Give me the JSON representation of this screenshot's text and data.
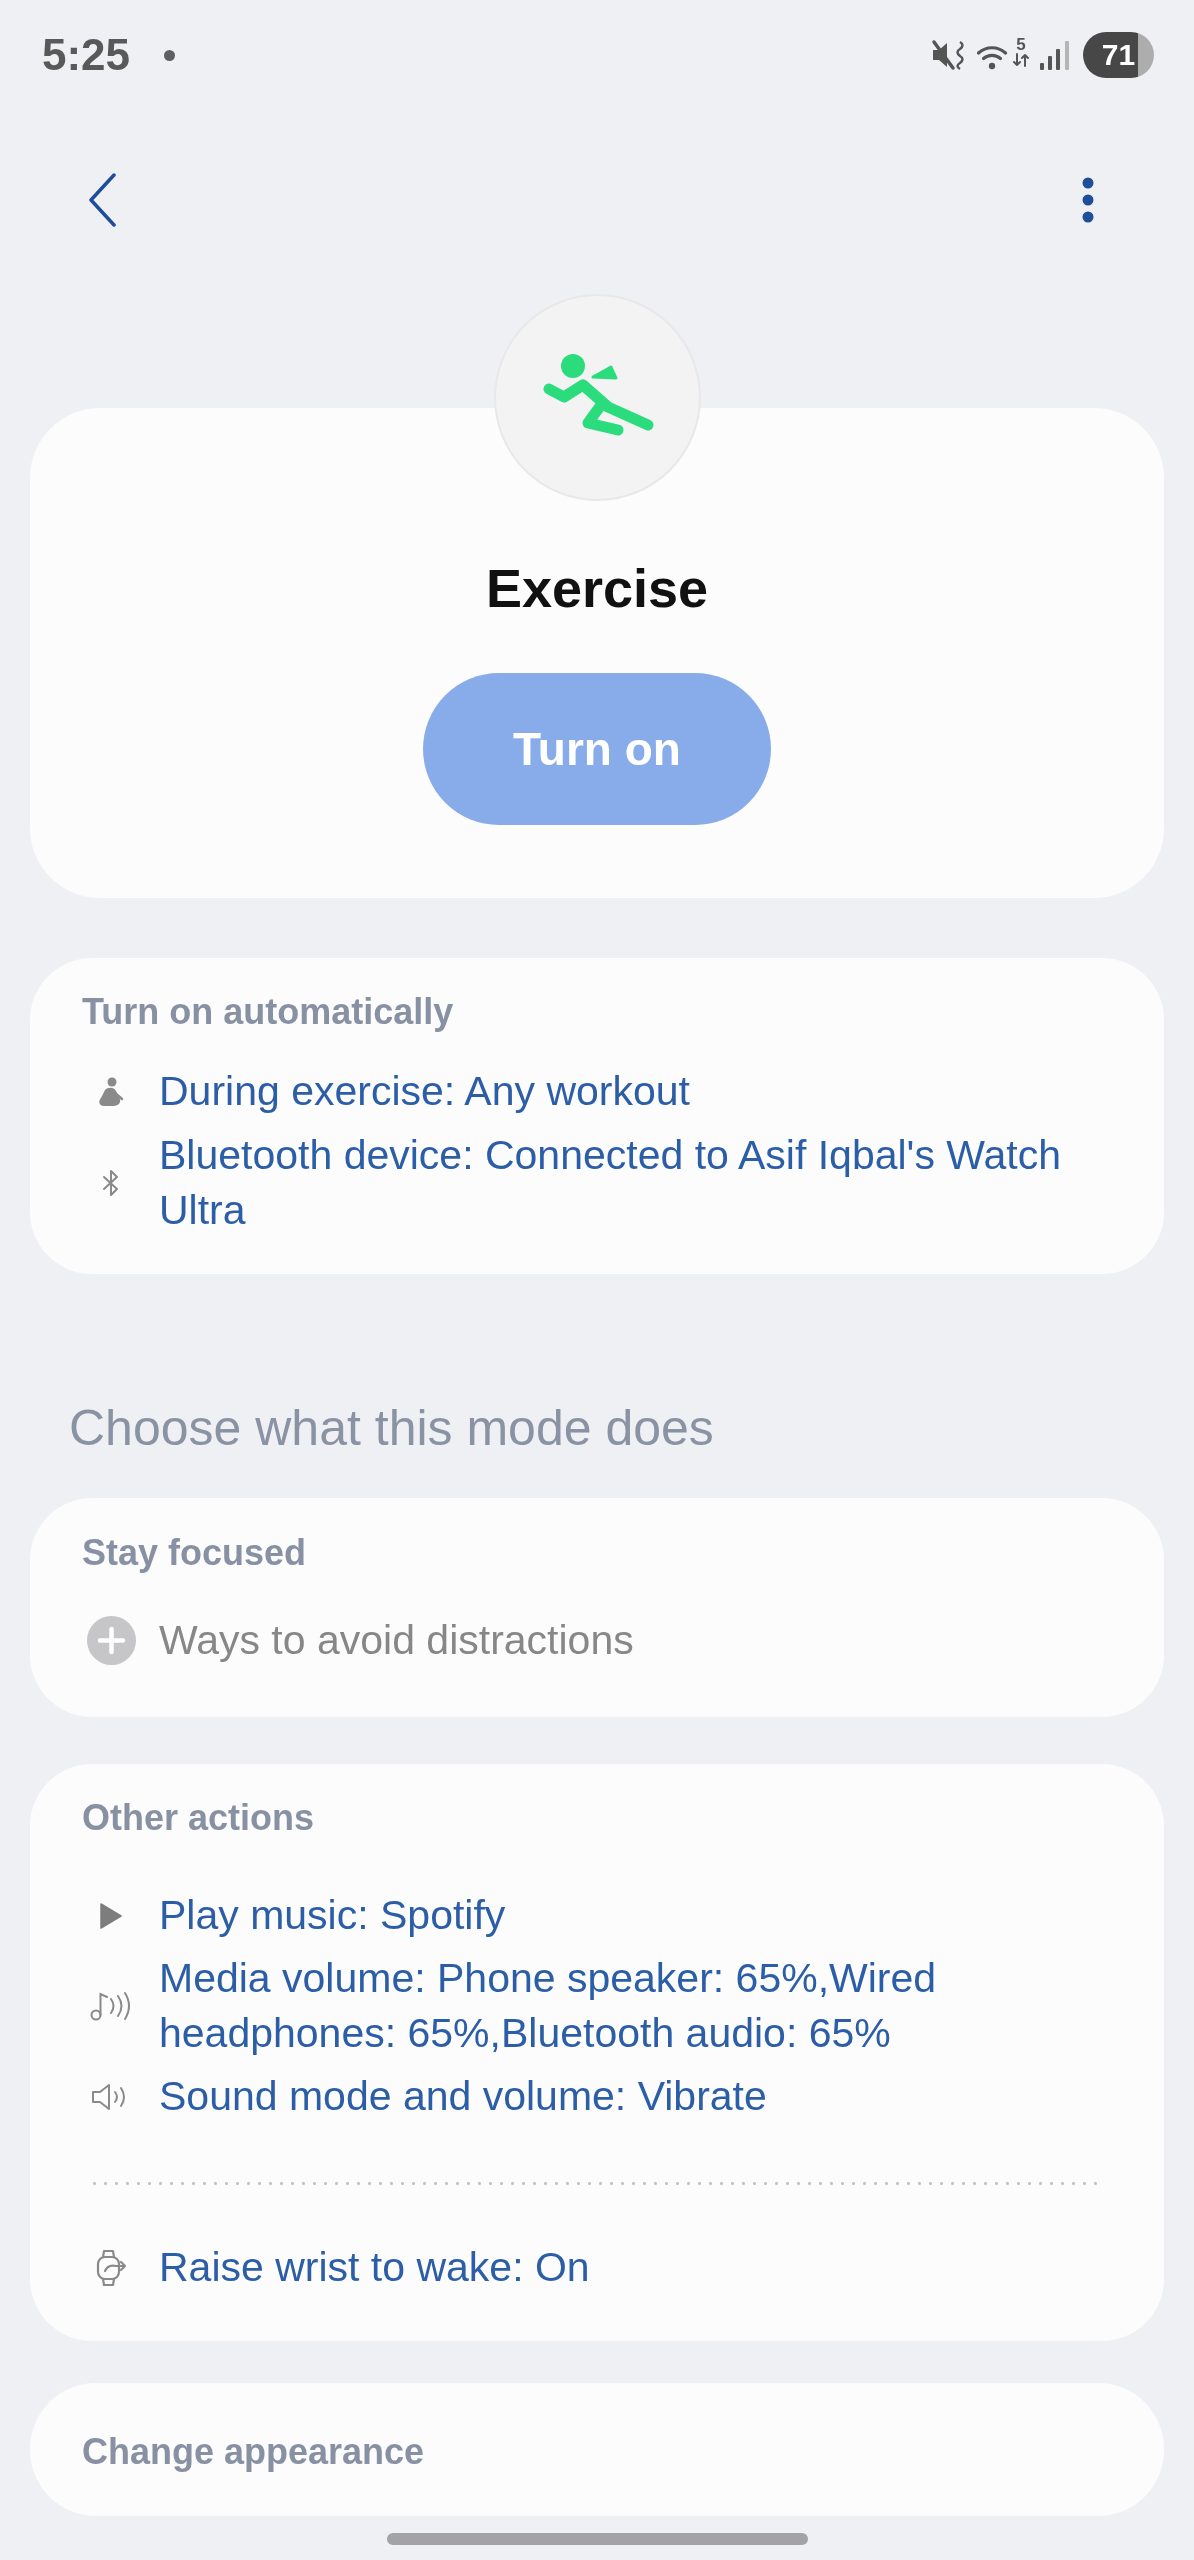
{
  "status_bar": {
    "time": "5:25",
    "wifi_band": "5",
    "battery": "71"
  },
  "mode": {
    "title": "Exercise",
    "button": "Turn on"
  },
  "automatic": {
    "title": "Turn on automatically",
    "items": [
      {
        "kind": "exercise",
        "text": "During exercise: Any workout"
      },
      {
        "kind": "bluetooth",
        "text": "Bluetooth device: Connected to Asif Iqbal's Watch Ultra"
      }
    ]
  },
  "section_title": "Choose what this mode does",
  "stay_focused": {
    "title": "Stay focused",
    "items": [
      {
        "kind": "add",
        "text": "Ways to avoid distractions"
      }
    ]
  },
  "other_actions": {
    "title": "Other actions",
    "groups": [
      [
        {
          "kind": "play",
          "text": "Play music: Spotify"
        },
        {
          "kind": "media_volume",
          "text": "Media volume: Phone speaker: 65%,Wired headphones: 65%,Bluetooth audio: 65%"
        },
        {
          "kind": "sound",
          "text": "Sound mode and volume: Vibrate"
        }
      ],
      [
        {
          "kind": "watch",
          "text": "Raise wrist to wake: On"
        }
      ]
    ]
  },
  "change_appearance": {
    "title": "Change appearance"
  }
}
